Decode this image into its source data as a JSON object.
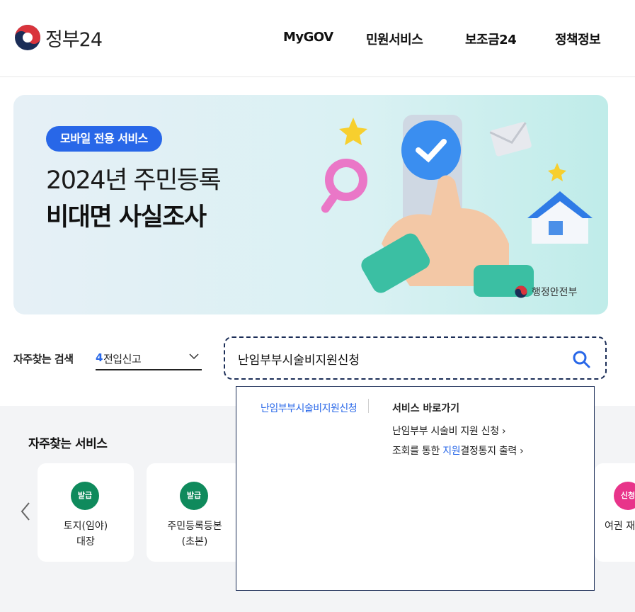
{
  "header": {
    "logo_text": "정부24",
    "nav": [
      "MyGOV",
      "민원서비스",
      "보조금24",
      "정책정보"
    ]
  },
  "banner": {
    "badge": "모바일 전용 서비스",
    "title_line1": "2024년 주민등록",
    "title_line2": "비대면 사실조사",
    "ministry": "행정안전부"
  },
  "search": {
    "label": "자주찾는 검색",
    "select_num": "4",
    "select_text": "전입신고",
    "query": "난임부부시술비지원신청"
  },
  "dropdown": {
    "keyword": "난임부부시술비지원신청",
    "shortcut_title": "서비스 바로가기",
    "items": [
      {
        "text": "난임부부 시술비 지원 신청 ›"
      },
      {
        "pre": "조회를 통한 ",
        "kw": "지원",
        "post": "결정통지 출력 ›"
      }
    ]
  },
  "favorites": {
    "title": "자주찾는 서비스",
    "cards": [
      {
        "badge": "발급",
        "name_line1": "토지(임야)",
        "name_line2": "대장"
      },
      {
        "badge": "발급",
        "name_line1": "주민등록등본",
        "name_line2": "(초본)"
      },
      {
        "badge": "신청",
        "name_line1": "여권 재"
      }
    ]
  },
  "colors": {
    "accent": "#2867e8",
    "badge_green": "#0f8a5c",
    "badge_pink": "#e8348a",
    "highlight": "#ffff3a"
  }
}
